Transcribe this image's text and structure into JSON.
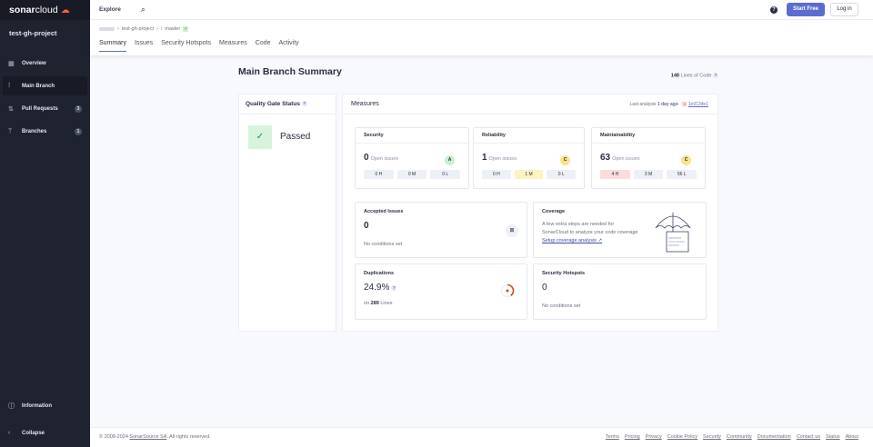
{
  "brand": {
    "name_bold": "sonar",
    "name_light": "cloud"
  },
  "sidebar": {
    "project": "test-gh-project",
    "items": [
      {
        "label": "Overview",
        "icon": "overview-icon"
      },
      {
        "label": "Main Branch",
        "icon": "branch-icon"
      },
      {
        "label": "Pull Requests",
        "icon": "pull-request-icon",
        "count": "3"
      },
      {
        "label": "Branches",
        "icon": "branches-icon",
        "count": "1"
      }
    ],
    "information": "Information",
    "collapse": "Collapse"
  },
  "topbar": {
    "explore": "Explore",
    "start_free": "Start Free",
    "login": "Log in"
  },
  "breadcrumb": {
    "project": "test-gh-project",
    "branch": "master"
  },
  "tabs": [
    "Summary",
    "Issues",
    "Security Hotspots",
    "Measures",
    "Code",
    "Activity"
  ],
  "summary": {
    "title": "Main Branch Summary",
    "loc_value": "148",
    "loc_label": "Lines of Code"
  },
  "quality_gate": {
    "title": "Quality Gate Status",
    "status": "Passed"
  },
  "measures": {
    "title": "Measures",
    "last_analysis_label": "Last analysis",
    "last_analysis_value": "1 day ago",
    "commit": "1e912de1",
    "ratings": [
      {
        "title": "Security",
        "count": "0",
        "label": "Open issues",
        "grade": "A",
        "grade_color": "#c7f0cf",
        "pills": [
          "0 H",
          "0 M",
          "0 L"
        ],
        "pill_colors": [
          "#eef0f7",
          "#eef0f7",
          "#eef0f7"
        ]
      },
      {
        "title": "Reliability",
        "count": "1",
        "label": "Open issues",
        "grade": "C",
        "grade_color": "#f8e48a",
        "pills": [
          "0 H",
          "1 M",
          "0 L"
        ],
        "pill_colors": [
          "#eef0f7",
          "#fcf2c2",
          "#eef0f7"
        ]
      },
      {
        "title": "Maintainability",
        "count": "63",
        "label": "Open issues",
        "grade": "C",
        "grade_color": "#f8e48a",
        "pills": [
          "4 H",
          "3 M",
          "56 L"
        ],
        "pill_colors": [
          "#fbdcdc",
          "#eef0f7",
          "#eef0f7"
        ]
      }
    ],
    "accepted": {
      "title": "Accepted Issues",
      "value": "0",
      "note": "No conditions set"
    },
    "coverage": {
      "title": "Coverage",
      "text1": "A few extra steps are needed for",
      "text2": "SonarCloud to analyze your code coverage",
      "link": "Setup coverage analysis"
    },
    "duplications": {
      "title": "Duplications",
      "value": "24.9%",
      "on": "on",
      "lines": "289",
      "lines_label": "Lines",
      "ring_fraction": 0.4
    },
    "hotspots": {
      "title": "Security Hotspots",
      "value": "0",
      "note": "No conditions set"
    }
  },
  "footer": {
    "copyright": "© 2008-2024",
    "company": "SonarSource SA",
    "rights": ". All rights reserved.",
    "links": [
      "Terms",
      "Pricing",
      "Privacy",
      "Cookie Policy",
      "Security",
      "Community",
      "Documentation",
      "Contact us",
      "Status",
      "About"
    ]
  }
}
